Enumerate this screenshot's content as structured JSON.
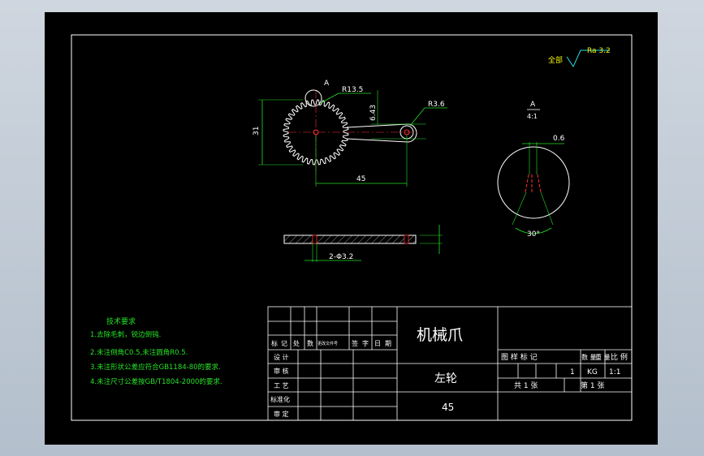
{
  "surface_finish": {
    "prefix": "全部",
    "value": "Ra 3.2"
  },
  "views": {
    "main": {
      "section_mark": "A",
      "dim_r_large": "R13.5",
      "dim_r_small": "R3.6",
      "dim_height": "31",
      "dim_offset": "6.43",
      "dim_center": "45"
    },
    "detail": {
      "title": "A",
      "scale": "4:1",
      "dim_width": "0.6",
      "dim_angle": "30°"
    },
    "section": {
      "dim_holes": "2-Φ3.2"
    }
  },
  "tech_notes": {
    "title": "技术要求",
    "items": [
      "1.去除毛刺，锐边倒钝.",
      "2.未注倒角C0.5,未注圆角R0.5.",
      "3.未注形状公差应符合GB1184-80的要求.",
      "4.未注尺寸公差按GB/T1804-2000的要求."
    ]
  },
  "title_block": {
    "header_labels": [
      "标",
      "记",
      "处",
      "数",
      "更改文件号",
      "签",
      "字",
      "日",
      "期"
    ],
    "row_labels": [
      "设 计",
      "审 核",
      "工 艺",
      "标准化",
      "审 定"
    ],
    "drawing_name": "机械爪",
    "part_name": "左轮",
    "material": "45",
    "attr_headers": [
      "图 样 标 记",
      "数 量",
      "重 量",
      "比 例"
    ],
    "quantity": "1",
    "weight": "KG",
    "scale": "1:1",
    "sheets_total": "共 1 张",
    "sheet_number": "第 1 张"
  }
}
